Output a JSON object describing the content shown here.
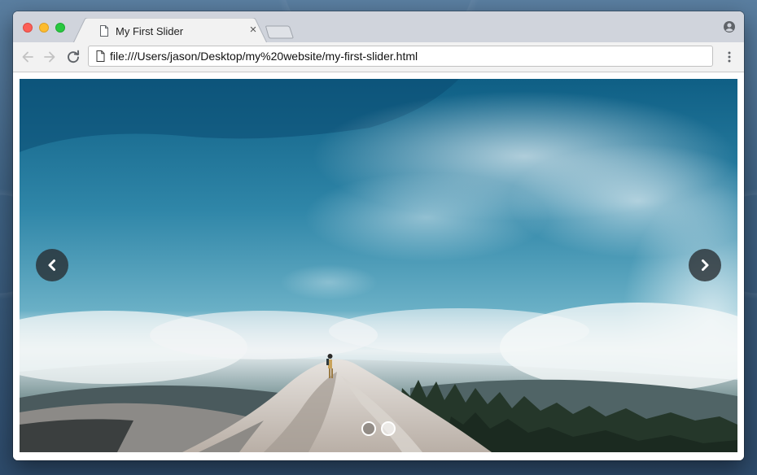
{
  "tab": {
    "title": "My First Slider",
    "close_label": "×"
  },
  "toolbar": {
    "url": "file:///Users/jason/Desktop/my%20website/my-first-slider.html"
  },
  "slider": {
    "slide_count": 2,
    "active_slide_index": 0
  },
  "icons": {
    "document": "doc-icon",
    "profile": "profile-icon",
    "back": "back-arrow-icon",
    "forward": "forward-arrow-icon",
    "reload": "reload-icon",
    "menu": "vertical-dots-icon",
    "prev": "chevron-left-icon",
    "next": "chevron-right-icon"
  },
  "colors": {
    "close_light": "#fc5f57",
    "minimize_light": "#fdbc2e",
    "maximize_light": "#28c840"
  }
}
